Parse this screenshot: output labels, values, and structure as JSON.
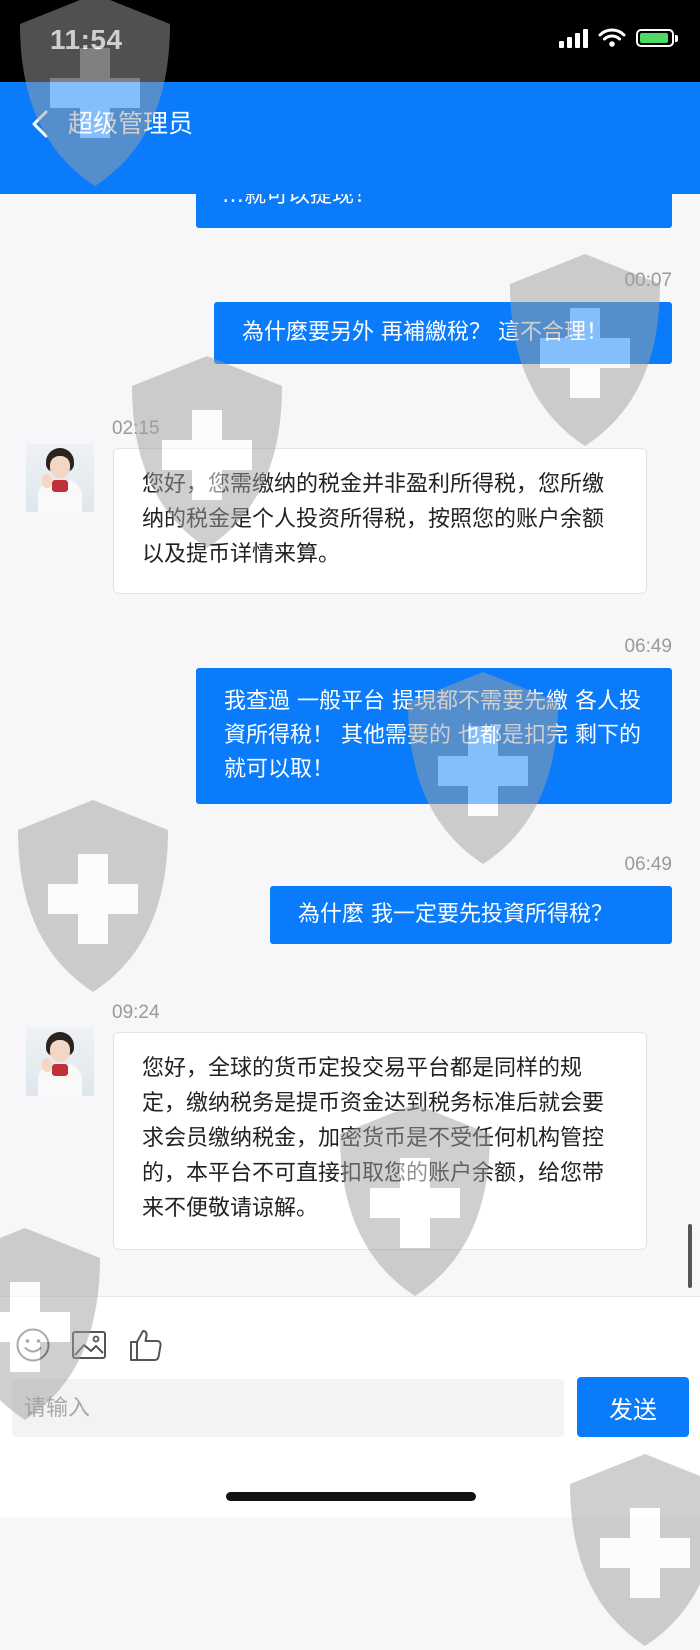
{
  "status_bar": {
    "time": "11:54"
  },
  "header": {
    "title": "超级管理员"
  },
  "messages": [
    {
      "side": "out",
      "text": "…就可以提现！",
      "time": ""
    },
    {
      "side": "out",
      "text": "為什麼要另外 再補繳稅？ 這不合理！",
      "time": "00:07"
    },
    {
      "side": "in",
      "text": "您好，您需缴纳的税金并非盈利所得税，您所缴纳的税金是个人投资所得税，按照您的账户余额以及提币详情来算。",
      "time": "02:15"
    },
    {
      "side": "out",
      "text": "我查過 一般平台 提現都不需要先繳 各人投資所得稅！ 其他需要的 也都是扣完 剩下的 就可以取！",
      "time": "06:49"
    },
    {
      "side": "out",
      "text": "為什麼 我一定要先投資所得稅？",
      "time": "06:49"
    },
    {
      "side": "in",
      "text": "您好，全球的货币定投交易平台都是同样的规定，缴纳税务是提币资金达到税务标准后就会要求会员缴纳税金，加密货币是不受任何机构管控的，本平台不可直接扣取您的账户余额，给您带来不便敬请谅解。",
      "time": "09:24"
    }
  ],
  "composer": {
    "placeholder": "请输入",
    "value": "",
    "send_label": "发送",
    "tools": [
      "emoji-icon",
      "image-icon",
      "thumbs-up-icon"
    ]
  },
  "colors": {
    "accent": "#0a7cfb",
    "background": "#f7f7f9"
  }
}
